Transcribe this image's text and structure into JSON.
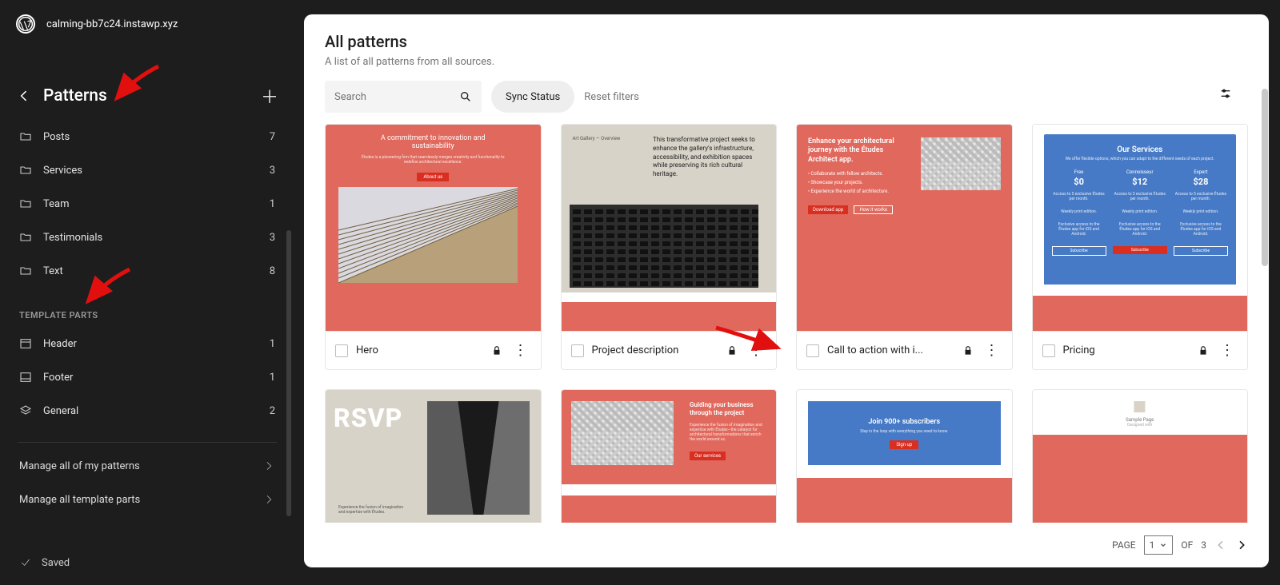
{
  "site": {
    "name": "calming-bb7c24.instawp.xyz"
  },
  "sidebar": {
    "title": "Patterns",
    "categories": [
      {
        "icon": "folder",
        "label": "Posts",
        "count": "7"
      },
      {
        "icon": "folder",
        "label": "Services",
        "count": "3"
      },
      {
        "icon": "folder",
        "label": "Team",
        "count": "1"
      },
      {
        "icon": "folder",
        "label": "Testimonials",
        "count": "3"
      },
      {
        "icon": "folder",
        "label": "Text",
        "count": "8"
      }
    ],
    "parts_label": "TEMPLATE PARTS",
    "parts": [
      {
        "icon": "header",
        "label": "Header",
        "count": "1"
      },
      {
        "icon": "footer",
        "label": "Footer",
        "count": "1"
      },
      {
        "icon": "general",
        "label": "General",
        "count": "2"
      }
    ],
    "manage": [
      "Manage all of my patterns",
      "Manage all template parts"
    ],
    "saved": "Saved"
  },
  "panel": {
    "title": "All patterns",
    "subtitle": "A list of all patterns from all sources.",
    "search_placeholder": "Search",
    "sync": "Sync Status",
    "reset": "Reset filters",
    "pager": {
      "page_label": "PAGE",
      "current": "1",
      "of_label": "OF",
      "total": "3"
    }
  },
  "patterns_row1": [
    {
      "name": "Hero"
    },
    {
      "name": "Project description"
    },
    {
      "name": "Call to action with i..."
    },
    {
      "name": "Pricing"
    }
  ],
  "patterns_row2": [
    {
      "name": ""
    },
    {
      "name": ""
    },
    {
      "name": ""
    },
    {
      "name": ""
    }
  ],
  "preview_text": {
    "hero_title": "A commitment to innovation and sustainability",
    "project_desc": "This transformative project seeks to enhance the gallery's infrastructure, accessibility, and exhibition spaces while preserving its rich cultural heritage.",
    "cta_title": "Enhance your architectural journey with the Études Architect app.",
    "pricing_title": "Our Services",
    "pricing_cols": [
      {
        "tier": "Free",
        "price": "$0"
      },
      {
        "tier": "Connoisseur",
        "price": "$12"
      },
      {
        "tier": "Expert",
        "price": "$28"
      }
    ],
    "rsvp": "RSVP",
    "guide": "Guiding your business through the project",
    "subscribe": "Join 900+ subscribers"
  }
}
